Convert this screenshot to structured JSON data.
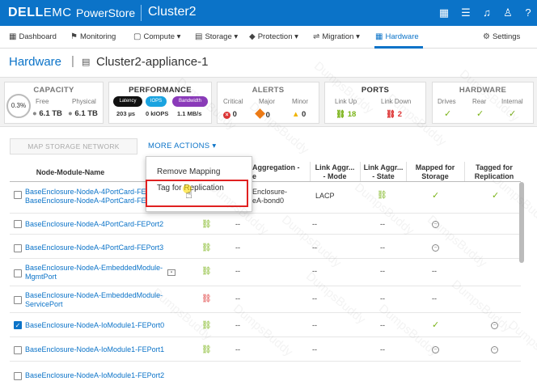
{
  "header": {
    "brand_dell": "DELL",
    "brand_emc": "EMC",
    "product": "PowerStore",
    "cluster": "Cluster2"
  },
  "nav": {
    "items": [
      "Dashboard",
      "Monitoring",
      "Compute",
      "Storage",
      "Protection",
      "Migration",
      "Hardware"
    ],
    "settings": "Settings"
  },
  "breadcrumb": {
    "title": "Hardware",
    "separator": "|",
    "appliance": "Cluster2-appliance-1"
  },
  "summary": {
    "capacity": {
      "title": "CAPACITY",
      "percent": "0.3%",
      "free_label": "Free",
      "free_value": "6.1 TB",
      "physical_label": "Physical",
      "physical_value": "6.1 TB"
    },
    "performance": {
      "title": "PERFORMANCE",
      "latency_label": "Latency",
      "iops_label": "IOPS",
      "bandwidth_label": "Bandwidth",
      "latency_value": "203 µs",
      "iops_value": "0 kIOPS",
      "bandwidth_value": "1.1 MB/s"
    },
    "alerts": {
      "title": "ALERTS",
      "critical_label": "Critical",
      "major_label": "Major",
      "minor_label": "Minor",
      "critical_value": "0",
      "major_value": "0",
      "minor_value": "0"
    },
    "ports": {
      "title": "PORTS",
      "linkup_label": "Link Up",
      "linkdown_label": "Link Down",
      "linkup_value": "18",
      "linkdown_value": "2"
    },
    "hardware": {
      "title": "HARDWARE",
      "drives_label": "Drives",
      "rear_label": "Rear",
      "internal_label": "Internal"
    }
  },
  "toolbar": {
    "map_network": "MAP STORAGE NETWORK",
    "more_actions": "MORE ACTIONS ▾"
  },
  "menu": {
    "remove_mapping": "Remove Mapping",
    "tag_replication": "Tag for Replication"
  },
  "table": {
    "headers": {
      "name": "Node-Module-Name",
      "aggregation_l1": "Aggregation -",
      "aggregation_l2": "e",
      "mode_l1": "Link Aggr... ",
      "mode_l2": "- Mode",
      "state_l1": "Link Aggr...",
      "state_l2": "- State",
      "mapped_l1": "Mapped for",
      "mapped_l2": "Storage",
      "tagged_l1": "Tagged for",
      "tagged_l2": "Replication"
    },
    "rows": [
      {
        "name_l1": "BaseEnclosure-NodeA-4PortCard-FE",
        "name_l2": "BaseEnclosure-NodeA-4PortCard-FE",
        "agg_l1": "Enclosure-",
        "agg_l2": "eA-bond0",
        "mode": "LACP"
      },
      {
        "name": "BaseEnclosure-NodeA-4PortCard-FEPort2",
        "dash": "--"
      },
      {
        "name": "BaseEnclosure-NodeA-4PortCard-FEPort3",
        "dash": "--"
      },
      {
        "name_l1": "BaseEnclosure-NodeA-EmbeddedModule-",
        "name_l2": "MgmtPort",
        "dash": "--"
      },
      {
        "name_l1": "BaseEnclosure-NodeA-EmbeddedModule-",
        "name_l2": "ServicePort",
        "dash": "--"
      },
      {
        "name": "BaseEnclosure-NodeA-IoModule1-FEPort0",
        "dash": "--"
      },
      {
        "name": "BaseEnclosure-NodeA-IoModule1-FEPort1",
        "dash": "--"
      },
      {
        "name": "BaseEnclosure-NodeA-IoModule1-FEPort2"
      }
    ]
  },
  "watermark": "DumpsBuddy"
}
